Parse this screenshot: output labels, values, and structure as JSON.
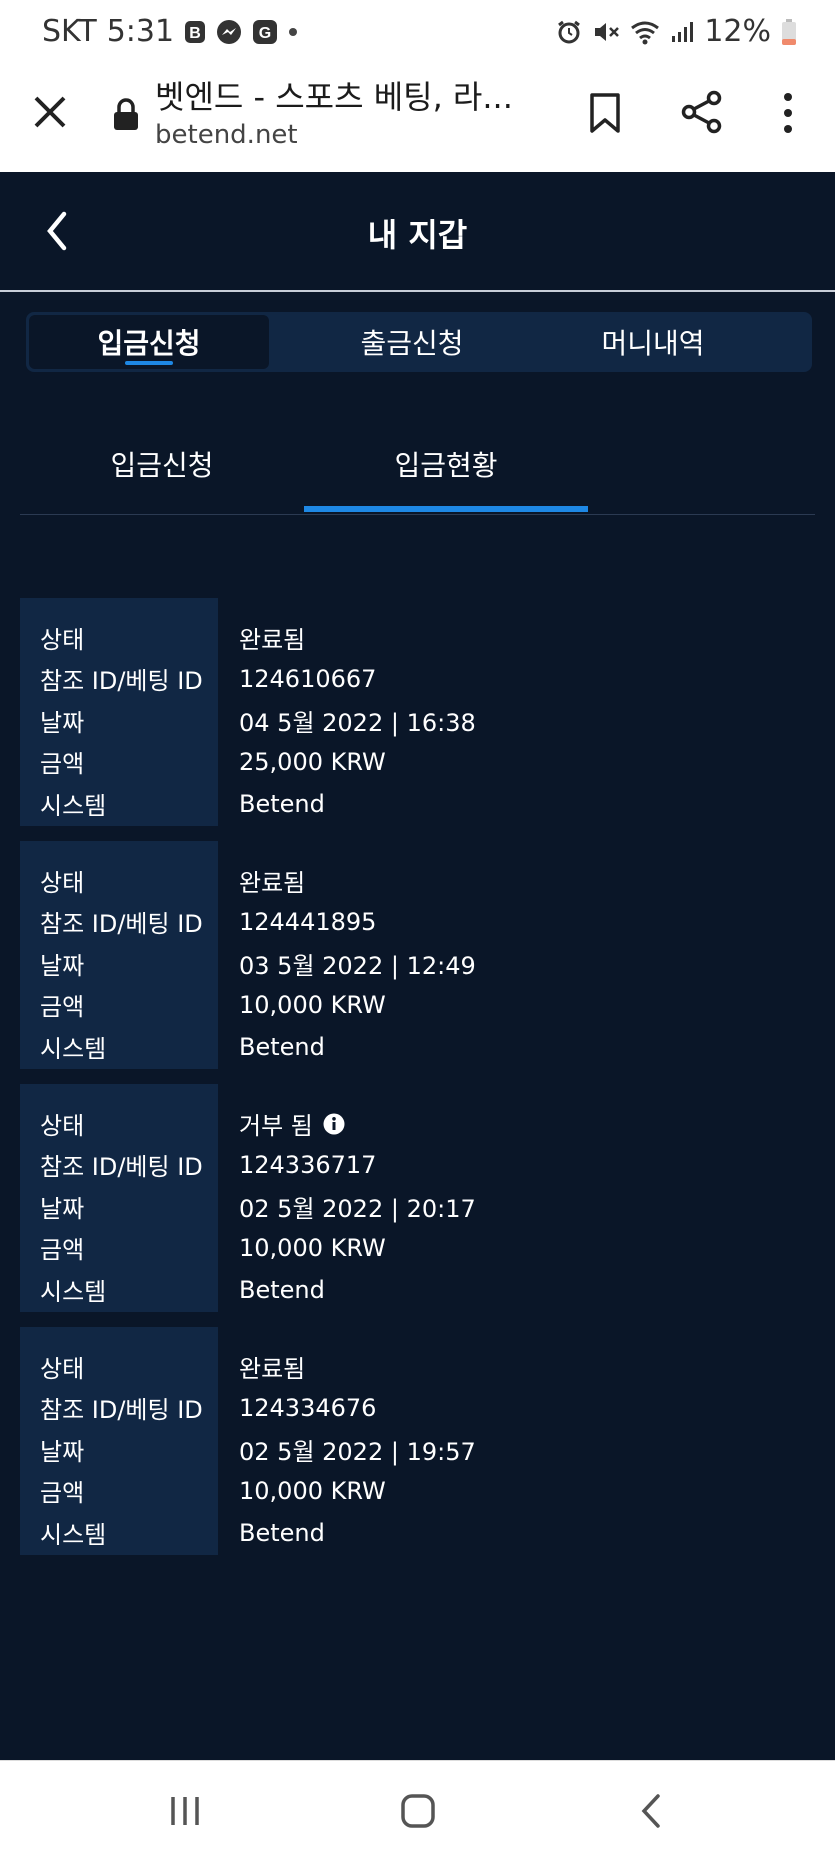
{
  "status_bar": {
    "carrier": "SKT",
    "time": "5:31",
    "battery": "12%"
  },
  "browser": {
    "title": "벳엔드 - 스포츠 베팅, 라...",
    "url": "betend.net"
  },
  "header": {
    "title": "내 지갑"
  },
  "top_tabs": [
    {
      "label": "입금신청"
    },
    {
      "label": "출금신청"
    },
    {
      "label": "머니내역"
    }
  ],
  "sub_tabs": [
    {
      "label": "입금신청"
    },
    {
      "label": "입금현황"
    }
  ],
  "labels": {
    "status": "상태",
    "ref_id": "참조 ID/베팅 ID",
    "date": "날짜",
    "amount": "금액",
    "system": "시스템"
  },
  "records": [
    {
      "status": "완료됨",
      "ref_id": "124610667",
      "date": "04 5월 2022 | 16:38",
      "amount": "25,000 KRW",
      "system": "Betend"
    },
    {
      "status": "완료됨",
      "ref_id": "124441895",
      "date": "03 5월 2022 | 12:49",
      "amount": "10,000 KRW",
      "system": "Betend"
    },
    {
      "status": "거부 됨",
      "ref_id": "124336717",
      "date": "02 5월 2022 | 20:17",
      "amount": "10,000 KRW",
      "system": "Betend"
    },
    {
      "status": "완료됨",
      "ref_id": "124334676",
      "date": "02 5월 2022 | 19:57",
      "amount": "10,000 KRW",
      "system": "Betend"
    }
  ],
  "colors": {
    "background": "#0a1628",
    "panel": "#112744",
    "accent": "#1e88e5"
  }
}
